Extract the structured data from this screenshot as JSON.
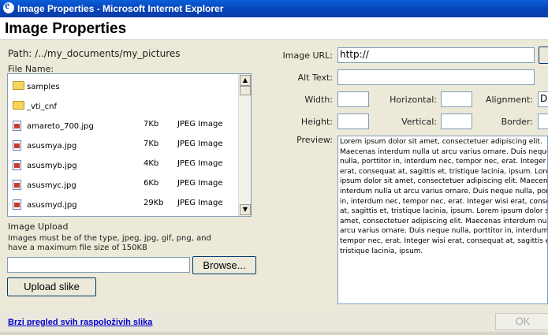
{
  "window": {
    "title": "Image Properties - Microsoft Internet Explorer"
  },
  "dialog": {
    "title": "Image Properties"
  },
  "file_browser": {
    "path_label": "Path: /../my_documents/my_pictures",
    "file_name_label": "File Name:",
    "items": [
      {
        "icon": "folder-icon",
        "name": "samples",
        "size": "",
        "type": ""
      },
      {
        "icon": "folder-icon",
        "name": "_vti_cnf",
        "size": "",
        "type": ""
      },
      {
        "icon": "image-file-icon",
        "name": "amareto_700.jpg",
        "size": "7Kb",
        "type": "JPEG Image"
      },
      {
        "icon": "image-file-icon",
        "name": "asusmya.jpg",
        "size": "7Kb",
        "type": "JPEG Image"
      },
      {
        "icon": "image-file-icon",
        "name": "asusmyb.jpg",
        "size": "4Kb",
        "type": "JPEG Image"
      },
      {
        "icon": "image-file-icon",
        "name": "asusmyc.jpg",
        "size": "6Kb",
        "type": "JPEG Image"
      },
      {
        "icon": "image-file-icon",
        "name": "asusmyd.jpg",
        "size": "29Kb",
        "type": "JPEG Image"
      }
    ]
  },
  "upload": {
    "label": "Image Upload",
    "note_line1": "Images must be of the type, jpeg, jpg, gif, png, and",
    "note_line2": "have a maximum file size of 150KB",
    "file_value": "",
    "browse_label": "Browse...",
    "upload_label": "Upload slike"
  },
  "properties": {
    "image_url_label": "Image URL:",
    "image_url_value": "http://",
    "alt_text_label": "Alt Text:",
    "alt_text_value": "",
    "width_label": "Width:",
    "width_value": "",
    "height_label": "Height:",
    "height_value": "",
    "horizontal_label": "Horizontal:",
    "horizontal_value": "",
    "vertical_label": "Vertical:",
    "vertical_value": "",
    "alignment_label": "Alignment:",
    "alignment_value": "D",
    "border_label": "Border:",
    "border_value": "",
    "preview_label": "Preview:",
    "preview_text": "Lorem ipsum dolor sit amet, consectetuer adipiscing elit. Maecenas interdum nulla ut arcu varius ornare. Duis neque nulla, porttitor in, interdum nec, tempor nec, erat. Integer wisi erat, consequat at, sagittis et, tristique lacinia, ipsum. Lorem ipsum dolor sit amet, consectetuer adipiscing elit. Maecenas interdum nulla ut arcu varius ornare. Duis neque nulla, porttitor in, interdum nec, tempor nec, erat. Integer wisi erat, consequat at, sagittis et, tristique lacinia, ipsum. Lorem ipsum dolor sit amet, consectetuer adipiscing elit. Maecenas interdum nulla ut arcu varius ornare. Duis neque nulla, porttitor in, interdum nec, tempor nec, erat. Integer wisi erat, consequat at, sagittis et, tristique lacinia, ipsum."
  },
  "footer": {
    "link_label": "Brzi pregled svih raspoloživih slika",
    "ok_label": "OK"
  }
}
